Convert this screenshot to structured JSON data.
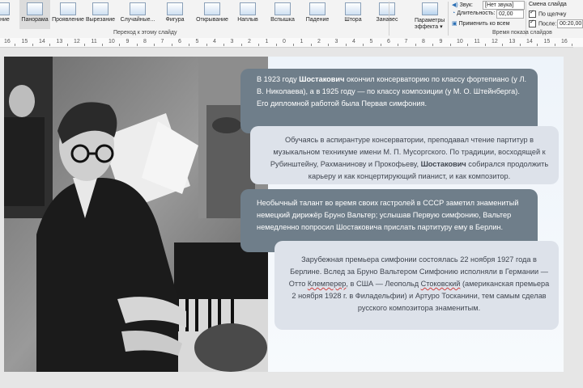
{
  "ribbon": {
    "transitions": [
      {
        "label": "ление"
      },
      {
        "label": "Панорама"
      },
      {
        "label": "Проявление"
      },
      {
        "label": "Вырезание"
      },
      {
        "label": "Случайные..."
      },
      {
        "label": "Фигура"
      },
      {
        "label": "Открывание"
      },
      {
        "label": "Наплыв"
      },
      {
        "label": "Вспышка"
      },
      {
        "label": "Падение"
      },
      {
        "label": "Штора"
      },
      {
        "label": "Занавес"
      }
    ],
    "effect_options_line1": "Параметры",
    "effect_options_line2": "эффекта",
    "group_transition": "Переход к этому слайду",
    "group_timing": "Время показа слайдов",
    "sound_label": "Звук:",
    "sound_value": "[Нет звука]",
    "duration_label": "Длительность:",
    "duration_value": "02,00",
    "apply_all": "Применить ко всем",
    "advance_label": "Смена слайда",
    "on_click_label": "По щелчку",
    "after_label": "После:",
    "after_value": "00:20,00"
  },
  "ruler": {
    "marks": [
      "16",
      "15",
      "14",
      "13",
      "12",
      "11",
      "10",
      "9",
      "8",
      "7",
      "6",
      "5",
      "4",
      "3",
      "2",
      "1",
      "0",
      "1",
      "2",
      "3",
      "4",
      "5",
      "6",
      "7",
      "8",
      "9",
      "10",
      "11",
      "12",
      "13",
      "14",
      "15",
      "16"
    ]
  },
  "slide": {
    "card1": {
      "pre": "В 1923 году ",
      "bold": "Шостакович",
      "post": " окончил консерваторию по классу фортепиано (у Л. В. Николаева), а в 1925 году — по классу композиции (у М. О. Штейнберга). Его дипломной работой была Первая симфония."
    },
    "card2": {
      "pre": "Обучаясь в аспирантуре консерватории, преподавал чтение партитур в музыкальном техникуме имени М. П. Мусоргского. По традиции, восходящей к Рубинштейну, Рахманинову и Прокофьеву, ",
      "bold": "Шостакович",
      "post": " собирался продолжить карьеру и как концертирующий пианист, и как композитор."
    },
    "card3": {
      "text": "Необычный талант во время своих гастролей в СССР заметил знаменитый немецкий дирижёр Бруно Вальтер; услышав Первую симфонию, Вальтер немедленно попросил Шостаковича прислать партитуру ему в Берлин."
    },
    "card4": {
      "part1": "Зарубежная премьера симфонии состоялась 22 ноября 1927 года в Берлине. Вслед за Бруно Вальтером Симфонию исполняли в Германии — Отто ",
      "name1": "Клемперер",
      "part2": ", в США — Леопольд ",
      "name2": "Стоковский",
      "part3": " (американская премьера 2 ноября 1928 г. в Филадельфии) и Артуро Тосканини, тем самым сделав русского композитора знаменитым."
    }
  }
}
